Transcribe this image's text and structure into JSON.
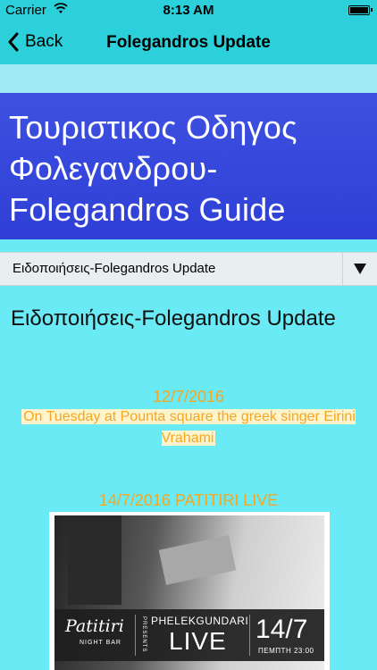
{
  "statusbar": {
    "carrier": "Carrier",
    "time": "8:13 AM"
  },
  "navbar": {
    "back_label": "Back",
    "title": "Folegandros Update"
  },
  "banner": {
    "title": "Τουριστικος Οδηγος Φολεγανδρου-Folegandros Guide"
  },
  "dropdown": {
    "selected": "Ειδοποιήσεις-Folegandros Update"
  },
  "content": {
    "heading": "Ειδοποιήσεις-Folegandros Update",
    "posts": [
      {
        "date": "12/7/2016",
        "text": "On Tuesday at Pounta square the greek singer Eirini Vrahami"
      },
      {
        "date": "14/7/2016 PATITIRI LIVE"
      }
    ],
    "poster": {
      "logo": "Patitiri",
      "logo_sub": "NIGHT BAR",
      "presents": "PRESENTS",
      "artist": "PHELEKGUNDARI",
      "live": "LIVE",
      "date": "14/7",
      "day_time": "ΠΕΜΠΤΗ 23:00"
    }
  }
}
